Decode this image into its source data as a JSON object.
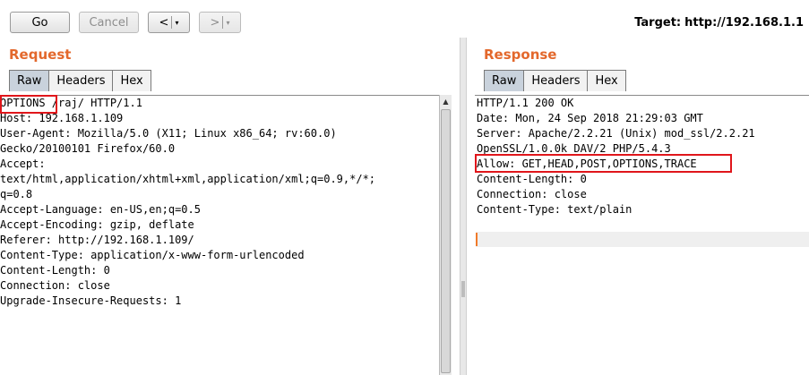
{
  "toolbar": {
    "go_label": "Go",
    "cancel_label": "Cancel",
    "back_label": "<",
    "forward_label": ">",
    "dropdown_glyph": "▾",
    "target_label": "Target:",
    "target_value": "http://192.168.1.1"
  },
  "request": {
    "title": "Request",
    "tabs": [
      "Raw",
      "Headers",
      "Hex"
    ],
    "active_tab": "Raw",
    "lines": [
      "OPTIONS /raj/ HTTP/1.1",
      "Host: 192.168.1.109",
      "User-Agent: Mozilla/5.0 (X11; Linux x86_64; rv:60.0)",
      "Gecko/20100101 Firefox/60.0",
      "Accept:",
      "text/html,application/xhtml+xml,application/xml;q=0.9,*/*;",
      "q=0.8",
      "Accept-Language: en-US,en;q=0.5",
      "Accept-Encoding: gzip, deflate",
      "Referer: http://192.168.1.109/",
      "Content-Type: application/x-www-form-urlencoded",
      "Content-Length: 0",
      "Connection: close",
      "Upgrade-Insecure-Requests: 1"
    ]
  },
  "response": {
    "title": "Response",
    "tabs": [
      "Raw",
      "Headers",
      "Hex"
    ],
    "active_tab": "Raw",
    "lines": [
      "HTTP/1.1 200 OK",
      "Date: Mon, 24 Sep 2018 21:29:03 GMT",
      "Server: Apache/2.2.21 (Unix) mod_ssl/2.2.21",
      "OpenSSL/1.0.0k DAV/2 PHP/5.4.3",
      "Allow: GET,HEAD,POST,OPTIONS,TRACE",
      "Content-Length: 0",
      "Connection: close",
      "Content-Type: text/plain"
    ]
  },
  "colors": {
    "accent_title": "#e3682c",
    "highlight": "#e0161b",
    "active_tab": "#c9d2dc"
  }
}
